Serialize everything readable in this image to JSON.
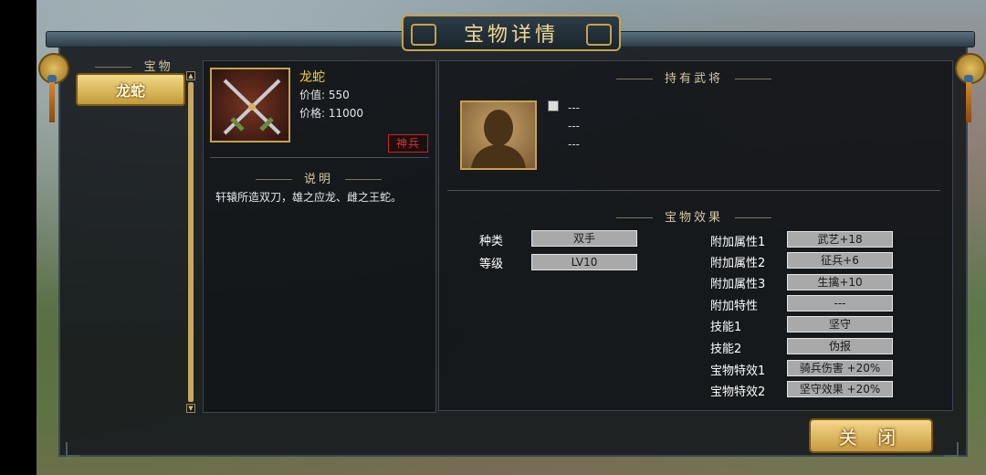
{
  "window": {
    "title": "宝物详情"
  },
  "left_panel": {
    "section_title": "宝物",
    "items": [
      {
        "label": "龙蛇",
        "selected": true
      }
    ]
  },
  "item": {
    "name": "龙蛇",
    "value_text": "价值: 550",
    "price_text": "价格: 11000",
    "badge": "神兵",
    "description_title": "说明",
    "description": "轩辕所造双刀，雄之应龙、雌之王蛇。"
  },
  "holder": {
    "section_title": "持有武将",
    "lines": [
      "---",
      "---",
      "---"
    ]
  },
  "effects": {
    "section_title": "宝物效果",
    "left": [
      {
        "label": "种类",
        "value": "双手"
      },
      {
        "label": "等级",
        "value": "LV10"
      }
    ],
    "right": [
      {
        "label": "附加属性1",
        "value": "武艺+18"
      },
      {
        "label": "附加属性2",
        "value": "征兵+6"
      },
      {
        "label": "附加属性3",
        "value": "生擒+10"
      },
      {
        "label": "附加特性",
        "value": "---"
      },
      {
        "label": "技能1",
        "value": "坚守"
      },
      {
        "label": "技能2",
        "value": "伪报"
      },
      {
        "label": "宝物特效1",
        "value": "骑兵伤害 +20%"
      },
      {
        "label": "宝物特效2",
        "value": "坚守效果 +20%"
      }
    ]
  },
  "buttons": {
    "close": "关 闭"
  },
  "colors": {
    "gold": "#c6a24c",
    "name_yellow": "#f0d040",
    "seal_red": "#e03030"
  }
}
